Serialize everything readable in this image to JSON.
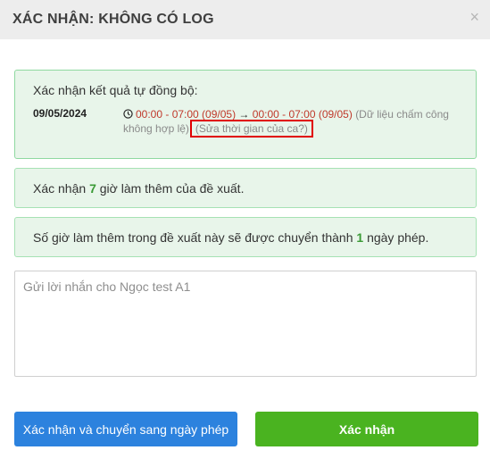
{
  "dialog": {
    "title": "XÁC NHẬN: KHÔNG CÓ LOG",
    "close_glyph": "×"
  },
  "sync_box": {
    "heading": "Xác nhận kết quả tự đồng bộ:",
    "date": "09/05/2024",
    "time_from": "00:00 - 07:00 (09/05)",
    "arrow": "→",
    "time_to": "00:00 - 07:00 (09/05)",
    "note": "(Dữ liệu chấm công không hợp lệ)",
    "edit_link": "(Sửa thời gian của ca?)"
  },
  "overtime_box": {
    "prefix": "Xác nhận",
    "hours": "7",
    "suffix": "giờ làm thêm của đề xuất."
  },
  "leave_box": {
    "prefix": "Số giờ làm thêm trong đề xuất này sẽ được chuyển thành",
    "days": "1",
    "suffix": "ngày phép."
  },
  "message": {
    "placeholder": "Gửi lời nhắn cho Ngọc test A1",
    "value": ""
  },
  "buttons": {
    "convert_label": "Xác nhận và chuyển sang ngày phép",
    "confirm_label": "Xác nhận"
  },
  "colors": {
    "accent_blue": "#2c82de",
    "accent_green": "#4ab320",
    "success_bg": "#e8f5ea",
    "error_red": "#c0392b",
    "highlight_border": "#e00000"
  },
  "icons": {
    "clock": "clock-icon",
    "close": "close-icon"
  }
}
